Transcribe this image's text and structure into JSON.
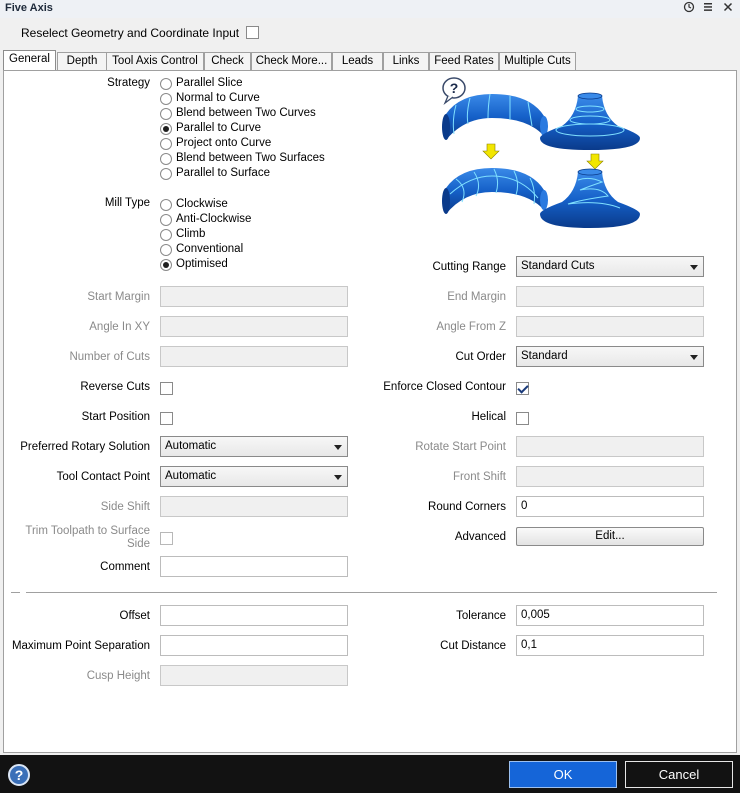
{
  "window": {
    "title": "Five Axis"
  },
  "reselect": {
    "label": "Reselect Geometry and Coordinate Input",
    "checked": false
  },
  "tabs": [
    {
      "label": "General",
      "active": true
    },
    {
      "label": "Depth"
    },
    {
      "label": "Tool Axis Control"
    },
    {
      "label": "Check"
    },
    {
      "label": "Check More..."
    },
    {
      "label": "Leads"
    },
    {
      "label": "Links"
    },
    {
      "label": "Feed Rates"
    },
    {
      "label": "Multiple Cuts"
    }
  ],
  "strategy": {
    "label": "Strategy",
    "options": [
      "Parallel Slice",
      "Normal to Curve",
      "Blend between Two Curves",
      "Parallel to Curve",
      "Project onto Curve",
      "Blend between Two Surfaces",
      "Parallel to Surface"
    ],
    "selected": "Parallel to Curve"
  },
  "mill_type": {
    "label": "Mill Type",
    "options": [
      "Clockwise",
      "Anti-Clockwise",
      "Climb",
      "Conventional",
      "Optimised"
    ],
    "selected": "Optimised"
  },
  "left_fields": {
    "start_margin": {
      "label": "Start Margin",
      "value": ""
    },
    "angle_in_xy": {
      "label": "Angle In XY",
      "value": ""
    },
    "number_of_cuts": {
      "label": "Number of Cuts",
      "value": ""
    },
    "reverse_cuts": {
      "label": "Reverse Cuts",
      "checked": false
    },
    "start_position": {
      "label": "Start Position",
      "checked": false
    },
    "preferred_rotary": {
      "label": "Preferred Rotary Solution",
      "value": "Automatic"
    },
    "tool_contact_point": {
      "label": "Tool Contact Point",
      "value": "Automatic"
    },
    "side_shift": {
      "label": "Side Shift",
      "value": ""
    },
    "trim_toolpath": {
      "label_line1": "Trim Toolpath to Surface",
      "label_line2": "Side",
      "checked": false
    },
    "comment": {
      "label": "Comment",
      "value": ""
    }
  },
  "right_fields": {
    "cutting_range": {
      "label": "Cutting Range",
      "value": "Standard Cuts"
    },
    "end_margin": {
      "label": "End Margin",
      "value": ""
    },
    "angle_from_z": {
      "label": "Angle From Z",
      "value": ""
    },
    "cut_order": {
      "label": "Cut Order",
      "value": "Standard"
    },
    "enforce_closed_contour": {
      "label": "Enforce Closed Contour",
      "checked": true
    },
    "helical": {
      "label": "Helical",
      "checked": false
    },
    "rotate_start_point": {
      "label": "Rotate Start Point",
      "value": ""
    },
    "front_shift": {
      "label": "Front Shift",
      "value": ""
    },
    "round_corners": {
      "label": "Round Corners",
      "value": "0"
    },
    "advanced": {
      "label": "Advanced",
      "button": "Edit..."
    }
  },
  "bottom_fields": {
    "offset": {
      "label": "Offset",
      "value": ""
    },
    "max_point_sep": {
      "label": "Maximum Point Separation",
      "value": ""
    },
    "cusp_height": {
      "label": "Cusp Height",
      "value": ""
    },
    "tolerance": {
      "label": "Tolerance",
      "value": "0,005"
    },
    "cut_distance": {
      "label": "Cut Distance",
      "value": "0,1"
    }
  },
  "footer": {
    "help": "?",
    "ok": "OK",
    "cancel": "Cancel"
  },
  "preview": {
    "help_glyph": "?"
  },
  "colors": {
    "accent": "#1565d8",
    "shape_blue": "#1560c8",
    "arrow_yellow": "#f2e600"
  }
}
